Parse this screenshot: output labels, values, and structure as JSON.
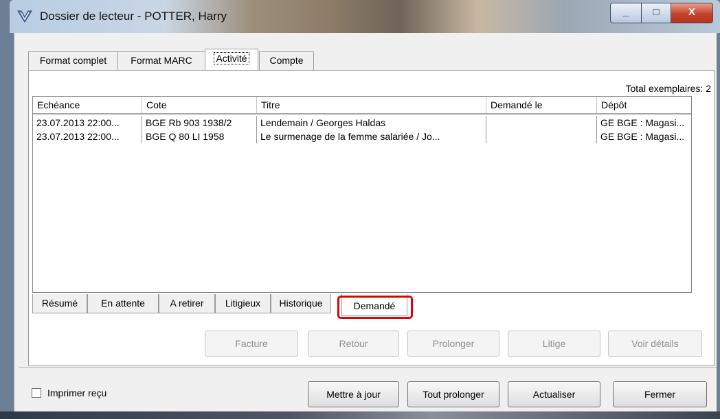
{
  "window": {
    "title": "Dossier de lecteur - POTTER, Harry",
    "controls": {
      "minimize": "_",
      "maximize": "□",
      "close": "X"
    }
  },
  "top_tabs": [
    {
      "label": "Format complet",
      "active": false
    },
    {
      "label": "Format MARC",
      "active": false
    },
    {
      "label": "Activité",
      "active": true
    },
    {
      "label": "Compte",
      "active": false
    }
  ],
  "total_label": "Total exemplaires: 2",
  "table": {
    "columns": [
      "Echéance",
      "Cote",
      "Titre",
      "Demandé le",
      "Dépôt"
    ],
    "rows": [
      [
        "23.07.2013 22:00...",
        "BGE Rb 903 1938/2",
        "Lendemain / Georges Haldas",
        "",
        "GE BGE : Magasi..."
      ],
      [
        "23.07.2013 22:00...",
        "BGE Q 80 LI 1958",
        "Le surmenage de la femme salariée / Jo...",
        "",
        "GE BGE : Magasi..."
      ]
    ]
  },
  "sub_tabs": [
    {
      "label": "Résumé",
      "active": false
    },
    {
      "label": "En attente",
      "active": false
    },
    {
      "label": "A retirer",
      "active": false
    },
    {
      "label": "Litigieux",
      "active": false
    },
    {
      "label": "Historique",
      "active": false
    },
    {
      "label": "Demandé",
      "active": true
    }
  ],
  "action_buttons": [
    {
      "label": "Facture",
      "enabled": false
    },
    {
      "label": "Retour",
      "enabled": false
    },
    {
      "label": "Prolonger",
      "enabled": false
    },
    {
      "label": "Litige",
      "enabled": false
    },
    {
      "label": "Voir détails",
      "enabled": false
    }
  ],
  "print_receipt": {
    "label": "Imprimer reçu",
    "checked": false
  },
  "footer_buttons": [
    {
      "label": "Mettre à jour"
    },
    {
      "label": "Tout prolonger"
    },
    {
      "label": "Actualiser"
    },
    {
      "label": "Fermer"
    }
  ],
  "colors": {
    "highlight": "#e00000",
    "disabled_text": "#8d8d8d"
  }
}
